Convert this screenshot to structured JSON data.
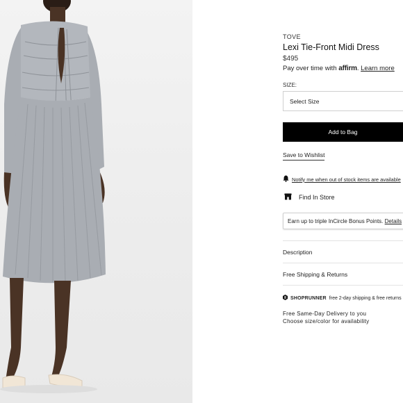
{
  "product": {
    "brand": "TOVE",
    "title": "Lexi Tie-Front Midi Dress",
    "price": "$495"
  },
  "financing": {
    "prefix": "Pay over time with",
    "provider": "affirm",
    "learn_more": "Learn more"
  },
  "size": {
    "label": "SIZE:",
    "selected": "Select Size"
  },
  "actions": {
    "add_to_bag": "Add to Bag",
    "save_to_wishlist": "Save to Wishlist",
    "notify": "Notify me when out of stock items are available",
    "find_in_store": "Find In Store"
  },
  "incircle": {
    "text": "Earn up to triple InCircle Bonus Points.",
    "details": "Details"
  },
  "accordions": {
    "description": "Description",
    "shipping": "Free Shipping & Returns"
  },
  "shoprunner": {
    "brand": "SHOPRUNNER",
    "text": "free 2-day shipping & free returns"
  },
  "same_day": {
    "line1": "Free Same-Day Delivery to you",
    "line2": "Choose size/color for availability"
  },
  "icons": {
    "notify": "bell-icon",
    "store": "store-icon",
    "shoprunner": "shoprunner-logo-icon"
  },
  "colors": {
    "primary_button": "#000000",
    "dress": "#a9adb3",
    "border": "#cfcfcf"
  }
}
